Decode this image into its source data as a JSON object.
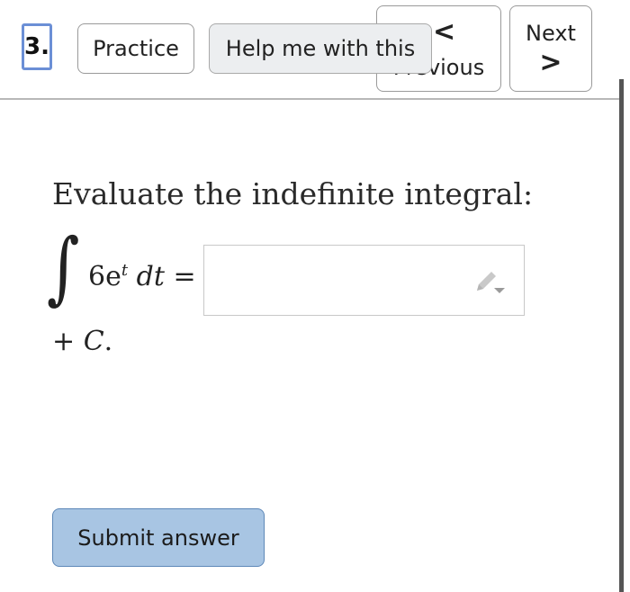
{
  "header": {
    "question_number": "3.",
    "practice_label": "Practice",
    "help_label": "Help me with this",
    "previous_label": "Previous",
    "next_label": "Next",
    "chevron_left": "<",
    "chevron_right": ">"
  },
  "question": {
    "prompt": "Evaluate the indefinite integral:",
    "integral_sign": "∫",
    "integrand_coefficient": "6e",
    "integrand_exponent": "t",
    "differential": "dt",
    "equals": "=",
    "answer_value": "",
    "constant_plus": "+",
    "constant_var": "C",
    "constant_period": "."
  },
  "actions": {
    "submit_label": "Submit answer"
  },
  "colors": {
    "accent_border": "#6b8fd6",
    "submit_bg": "#a8c5e3",
    "help_bg": "#eceef0"
  }
}
